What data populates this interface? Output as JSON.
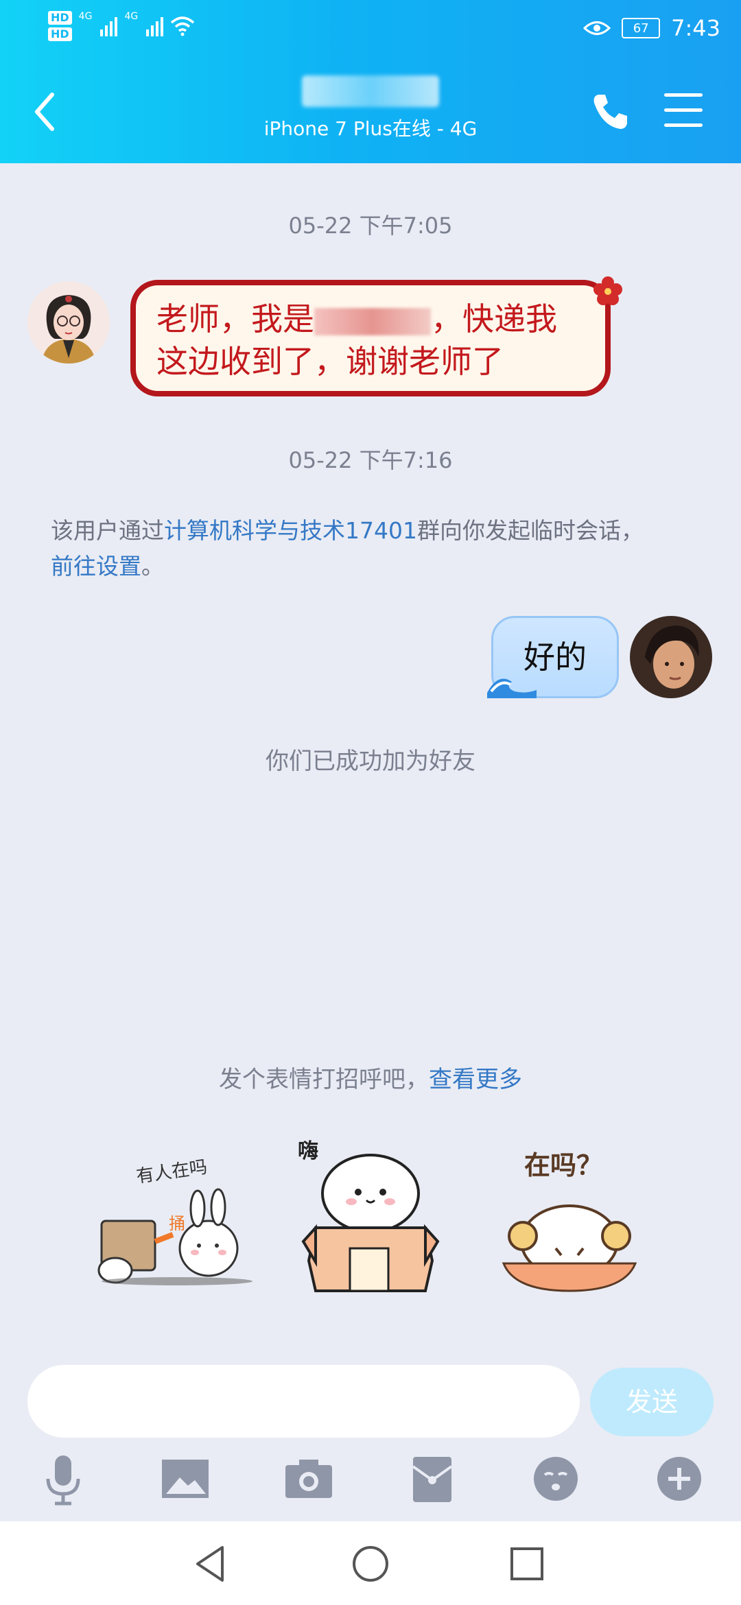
{
  "status_bar": {
    "network_label_1": "4G",
    "network_label_2": "4G",
    "hd_1": "HD",
    "hd_2": "HD",
    "battery": "67",
    "time": "7:43"
  },
  "header": {
    "subtitle": "iPhone 7 Plus在线 - 4G"
  },
  "messages": {
    "timestamp_1": "05-22 下午7:05",
    "incoming_text_part1": "老师，我是",
    "incoming_text_part2": "，快递我",
    "incoming_text_line2": "这边收到了，谢谢老师了",
    "timestamp_2": "05-22 下午7:16",
    "system_prefix": "该用户通过",
    "system_group_link": "计算机科学与技术17401",
    "system_suffix": "群向你发起临时会话，",
    "system_settings_link": "前往设置",
    "system_end": "。",
    "outgoing_text": "好的",
    "friend_added": "你们已成功加为好友"
  },
  "stickers": {
    "prompt": "发个表情打招呼吧，",
    "see_more": "查看更多",
    "sticker_1_text": "有人在吗",
    "sticker_1_side": "捅",
    "sticker_2_text": "嗨",
    "sticker_3_text": "在吗？"
  },
  "input": {
    "placeholder": "",
    "send_label": "发送"
  },
  "colors": {
    "header_start": "#12d2f7",
    "header_end": "#1aa0f2",
    "link": "#3478c6",
    "red_bubble_border": "#b3161b",
    "send_button": "#bfeafd"
  }
}
